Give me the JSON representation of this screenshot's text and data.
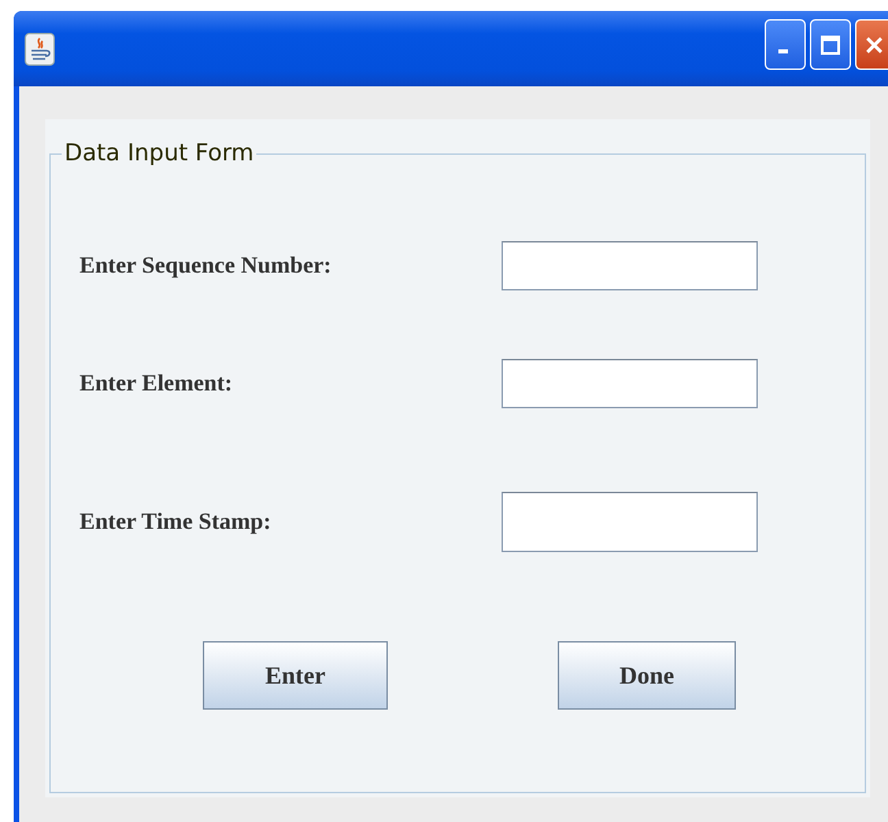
{
  "form": {
    "legend": "Data Input Form",
    "fields": [
      {
        "label": "Enter Sequence Number:",
        "tall": false
      },
      {
        "label": "Enter Element:",
        "tall": false
      },
      {
        "label": "Enter Time Stamp:",
        "tall": true
      }
    ],
    "buttons": [
      "Enter",
      "Done"
    ]
  }
}
